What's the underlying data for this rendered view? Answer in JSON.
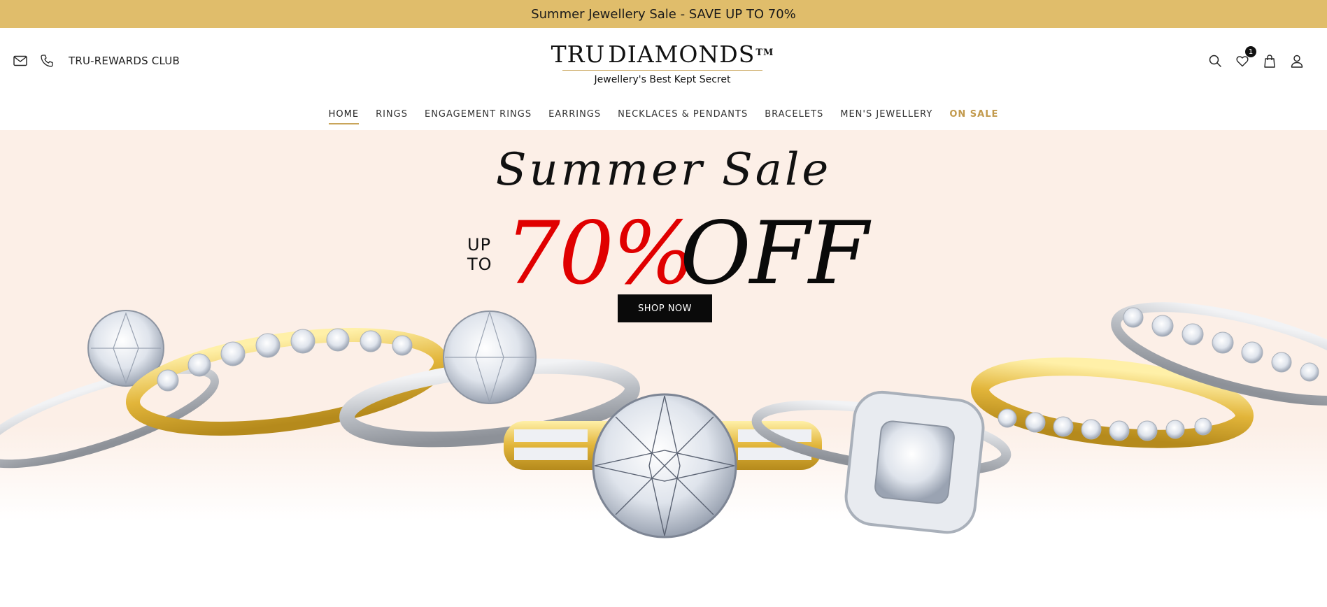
{
  "announcement": {
    "text": "Summer Jewellery Sale - SAVE UP TO 70%"
  },
  "header": {
    "club_label": "TRU-REWARDS CLUB",
    "logo": {
      "name": "TRU",
      "name2": "DIAMONDS",
      "trademark": "TM",
      "tagline": "Jewellery's Best Kept Secret"
    },
    "wishlist_count": "1"
  },
  "nav": {
    "items": [
      {
        "label": "HOME"
      },
      {
        "label": "RINGS"
      },
      {
        "label": "ENGAGEMENT RINGS"
      },
      {
        "label": "EARRINGS"
      },
      {
        "label": "NECKLACES & PENDANTS"
      },
      {
        "label": "BRACELETS"
      },
      {
        "label": "MEN'S JEWELLERY"
      },
      {
        "label": "ON SALE"
      }
    ]
  },
  "hero": {
    "script_title": "Summer Sale",
    "up": "UP",
    "to": "TO",
    "percent": "70%",
    "off": "OFF",
    "cta": "SHOP NOW",
    "colors": {
      "background": "#fcefe7",
      "percent": "#e00000",
      "gold": "#e2b53a",
      "silver": "#c8ccd2"
    }
  },
  "colors": {
    "announce_bg": "#e0bd6b",
    "accent": "#c9a55a",
    "sale_link": "#c29a4d"
  },
  "icons": [
    "mail-icon",
    "phone-icon",
    "search-icon",
    "heart-icon",
    "bag-icon",
    "user-icon",
    "diamond-logo-icon"
  ]
}
